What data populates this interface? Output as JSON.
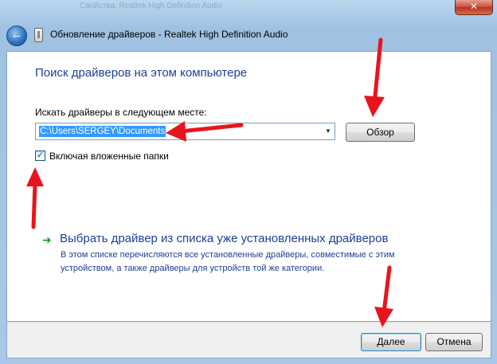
{
  "background_window": {
    "title": "Свойства: Realtek High Definition Audio"
  },
  "titlebar": {
    "title": "Обновление драйверов - Realtek High Definition Audio",
    "close_label": "✕",
    "back_icon": "back-arrow-icon"
  },
  "page": {
    "heading": "Поиск драйверов на этом компьютере",
    "search_label": "Искать драйверы в следующем месте:",
    "path_value": "C:\\Users\\SERGEY\\Documents",
    "browse_label": "Обзор",
    "include_subfolders_label": "Включая вложенные папки",
    "include_subfolders_checked": true,
    "pick_link": "Выбрать драйвер из списка уже установленных драйверов",
    "pick_description": "В этом списке перечисляются все установленные драйверы, совместимые с этим устройством, а также драйверы для устройств той же категории."
  },
  "footer": {
    "next_label": "Далее",
    "cancel_label": "Отмена"
  },
  "colors": {
    "annotation_arrow": "#e8141c",
    "link_blue": "#1e3f99",
    "green_arrow": "#1f9a2c"
  }
}
